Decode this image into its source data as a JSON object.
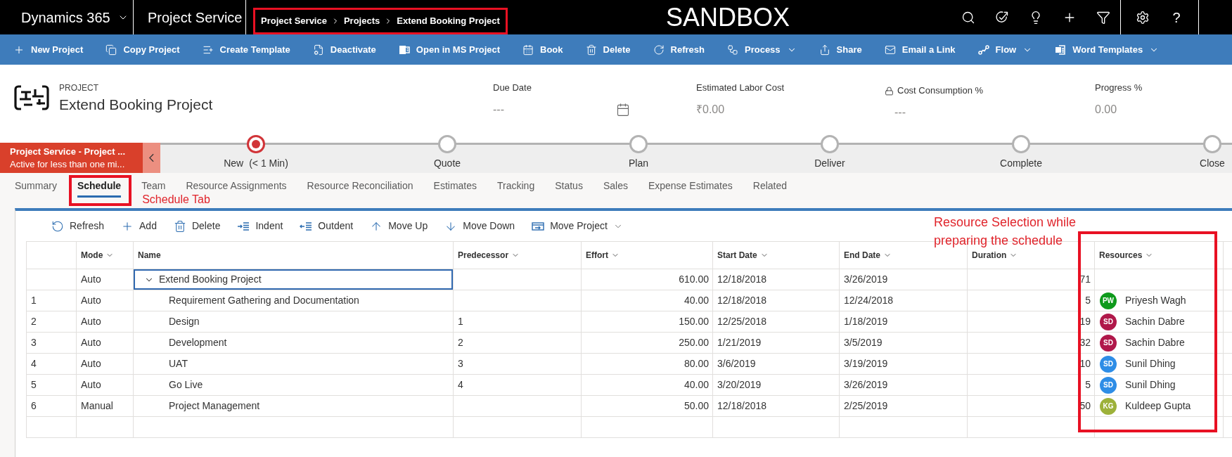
{
  "top_bar": {
    "app_name": "Dynamics 365",
    "area": "Project Service",
    "breadcrumb": {
      "highlighted": true,
      "items": [
        "Project Service",
        "Projects",
        "Extend Booking Project"
      ]
    },
    "environment": "SANDBOX",
    "help": "?"
  },
  "command_bar": [
    {
      "label": "New Project",
      "has_menu": false
    },
    {
      "label": "Copy Project",
      "has_menu": false
    },
    {
      "label": "Create Template",
      "has_menu": false
    },
    {
      "label": "Deactivate",
      "has_menu": false
    },
    {
      "label": "Open in MS Project",
      "has_menu": false
    },
    {
      "label": "Book",
      "has_menu": false
    },
    {
      "label": "Delete",
      "has_menu": false
    },
    {
      "label": "Refresh",
      "has_menu": false
    },
    {
      "label": "Process",
      "has_menu": true
    },
    {
      "label": "Share",
      "has_menu": false
    },
    {
      "label": "Email a Link",
      "has_menu": false
    },
    {
      "label": "Flow",
      "has_menu": true
    },
    {
      "label": "Word Templates",
      "has_menu": true
    }
  ],
  "header": {
    "entity_type": "PROJECT",
    "title": "Extend Booking Project",
    "fields": [
      {
        "label": "Due Date",
        "value": "---",
        "kind": "date",
        "locked": false
      },
      {
        "label": "Estimated Labor Cost",
        "value": "₹0.00",
        "kind": "text",
        "locked": false
      },
      {
        "label": "Cost Consumption %",
        "value": "---",
        "kind": "text",
        "locked": true
      },
      {
        "label": "Progress %",
        "value": "0.00",
        "kind": "text",
        "locked": false
      }
    ]
  },
  "process": {
    "active_stage": {
      "title": "Project Service - Project ...",
      "status": "Active for less than one mi..."
    },
    "stages": [
      {
        "label": "New",
        "duration": "(< 1 Min)",
        "selected": true
      },
      {
        "label": "Quote",
        "selected": false
      },
      {
        "label": "Plan",
        "selected": false
      },
      {
        "label": "Deliver",
        "selected": false
      },
      {
        "label": "Complete",
        "selected": false
      },
      {
        "label": "Close",
        "selected": false
      }
    ]
  },
  "tabs": [
    {
      "label": "Summary",
      "selected": false,
      "highlighted": false
    },
    {
      "label": "Schedule",
      "selected": true,
      "highlighted": true,
      "callout": "Schedule Tab"
    },
    {
      "label": "Team",
      "selected": false,
      "highlighted": false
    },
    {
      "label": "Resource Assignments",
      "selected": false,
      "highlighted": false
    },
    {
      "label": "Resource Reconciliation",
      "selected": false,
      "highlighted": false
    },
    {
      "label": "Estimates",
      "selected": false,
      "highlighted": false
    },
    {
      "label": "Tracking",
      "selected": false,
      "highlighted": false
    },
    {
      "label": "Status",
      "selected": false,
      "highlighted": false
    },
    {
      "label": "Sales",
      "selected": false,
      "highlighted": false
    },
    {
      "label": "Expense Estimates",
      "selected": false,
      "highlighted": false
    },
    {
      "label": "Related",
      "selected": false,
      "highlighted": false
    }
  ],
  "schedule_toolbar": [
    {
      "label": "Refresh",
      "has_menu": false
    },
    {
      "label": "Add",
      "has_menu": false
    },
    {
      "label": "Delete",
      "has_menu": false
    },
    {
      "label": "Indent",
      "has_menu": false
    },
    {
      "label": "Outdent",
      "has_menu": false
    },
    {
      "label": "Move Up",
      "has_menu": false
    },
    {
      "label": "Move Down",
      "has_menu": false
    },
    {
      "label": "Move Project",
      "has_menu": true
    }
  ],
  "table": {
    "columns": [
      {
        "label": "Mode",
        "has_menu": true,
        "highlighted": false
      },
      {
        "label": "Name",
        "has_menu": false,
        "highlighted": false
      },
      {
        "label": "Predecessor",
        "has_menu": true,
        "highlighted": false
      },
      {
        "label": "Effort",
        "has_menu": true,
        "highlighted": false
      },
      {
        "label": "Start Date",
        "has_menu": true,
        "highlighted": false
      },
      {
        "label": "End Date",
        "has_menu": true,
        "highlighted": false
      },
      {
        "label": "Duration",
        "has_menu": true,
        "highlighted": false
      },
      {
        "label": "Resources",
        "has_menu": true,
        "highlighted": true,
        "callout": "Resource Selection while preparing the schedule"
      }
    ],
    "rows": [
      {
        "mode": "Auto",
        "name": "Extend Booking Project",
        "expanded": true,
        "selected": true,
        "effort": "610.00",
        "start_date": "12/18/2018",
        "end_date": "3/26/2019",
        "duration": "71",
        "children": [
          {
            "number": "1",
            "mode": "Auto",
            "name": "Requirement Gathering and Documentation",
            "selected": false,
            "effort": "40.00",
            "start_date": "12/18/2018",
            "end_date": "12/24/2018",
            "duration": "5",
            "resource": {
              "initials": "PW",
              "name": "Priyesh Wagh",
              "color": "#0e9a1c"
            }
          },
          {
            "number": "2",
            "mode": "Auto",
            "name": "Design",
            "selected": false,
            "predecessor": "1",
            "effort": "150.00",
            "start_date": "12/25/2018",
            "end_date": "1/18/2019",
            "duration": "19",
            "resource": {
              "initials": "SD",
              "name": "Sachin Dabre",
              "color": "#b0184a"
            }
          },
          {
            "number": "3",
            "mode": "Auto",
            "name": "Development",
            "selected": false,
            "predecessor": "2",
            "effort": "250.00",
            "start_date": "1/21/2019",
            "end_date": "3/5/2019",
            "duration": "32",
            "resource": {
              "initials": "SD",
              "name": "Sachin Dabre",
              "color": "#b0184a"
            }
          },
          {
            "number": "4",
            "mode": "Auto",
            "name": "UAT",
            "selected": false,
            "predecessor": "3",
            "effort": "80.00",
            "start_date": "3/6/2019",
            "end_date": "3/19/2019",
            "duration": "10",
            "resource": {
              "initials": "SD",
              "name": "Sunil Dhing",
              "color": "#2e8de6"
            }
          },
          {
            "number": "5",
            "mode": "Auto",
            "name": "Go Live",
            "selected": false,
            "predecessor": "4",
            "effort": "40.00",
            "start_date": "3/20/2019",
            "end_date": "3/26/2019",
            "duration": "5",
            "resource": {
              "initials": "SD",
              "name": "Sunil Dhing",
              "color": "#2e8de6"
            }
          },
          {
            "number": "6",
            "mode": "Manual",
            "name": "Project Management",
            "selected": false,
            "effort": "50.00",
            "start_date": "12/18/2018",
            "end_date": "2/25/2019",
            "duration": "50",
            "resource": {
              "initials": "KG",
              "name": "Kuldeep Gupta",
              "color": "#9db13a"
            }
          }
        ]
      }
    ]
  }
}
